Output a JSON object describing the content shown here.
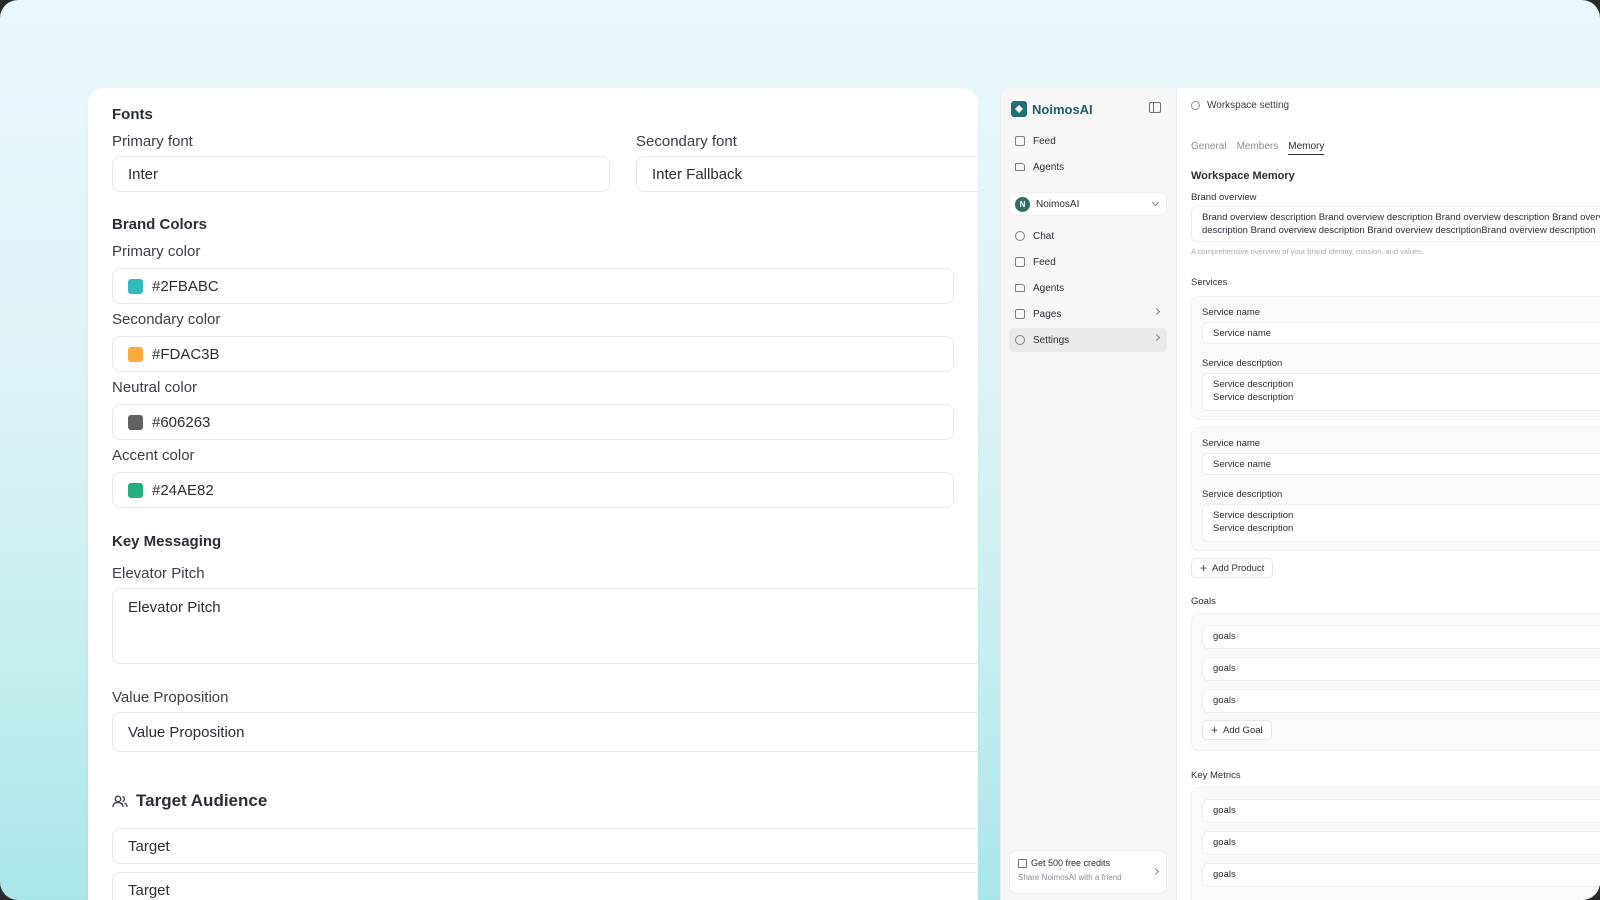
{
  "left": {
    "fonts_heading": "Fonts",
    "primary_font_label": "Primary font",
    "primary_font_value": "Inter",
    "secondary_font_label": "Secondary font",
    "secondary_font_value": "Inter Fallback",
    "brand_colors_heading": "Brand Colors",
    "colors": [
      {
        "label": "Primary color",
        "value": "#2FBABC",
        "swatch": "#2FBABC"
      },
      {
        "label": "Secondary color",
        "value": "#FDAC3B",
        "swatch": "#FDAC3B"
      },
      {
        "label": "Neutral color",
        "value": "#606263",
        "swatch": "#606263"
      },
      {
        "label": "Accent color",
        "value": "#24AE82",
        "swatch": "#24AE82"
      }
    ],
    "key_messaging_heading": "Key Messaging",
    "elevator_label": "Elevator Pitch",
    "elevator_value": "Elevator Pitch",
    "value_prop_label": "Value Proposition",
    "value_prop_value": "Value Proposition",
    "target_heading": "Target Audience",
    "target_icon": "users-icon",
    "targets": [
      "Target",
      "Target"
    ]
  },
  "app": {
    "brand": "NoimosAI",
    "nav_top": [
      {
        "label": "Feed",
        "icon": "feed-icon"
      },
      {
        "label": "Agents",
        "icon": "folder-icon"
      }
    ],
    "workspace": {
      "initial": "N",
      "name": "NoimosAI"
    },
    "nav_ws": [
      {
        "label": "Chat",
        "icon": "chat-icon"
      },
      {
        "label": "Feed",
        "icon": "feed-icon"
      },
      {
        "label": "Agents",
        "icon": "folder-icon"
      },
      {
        "label": "Pages",
        "icon": "pages-icon"
      },
      {
        "label": "Settings",
        "icon": "gear-icon"
      }
    ],
    "credits_title": "Get 500 free credits",
    "credits_sub": "Share NoimosAI with a friend"
  },
  "main": {
    "header": "Workspace setting",
    "tabs": [
      "General",
      "Members",
      "Memory"
    ],
    "active_tab": "Memory",
    "title": "Workspace Memory",
    "brand_overview_label": "Brand overview",
    "brand_overview_line1": "Brand overview description Brand overview description Brand overview description Brand overview",
    "brand_overview_line2": "description Brand overview description Brand overview descriptionBrand overview description",
    "brand_overview_help": "A comprehensive overview of your brand identity, mission, and values.",
    "services_label": "Services",
    "services": [
      {
        "name_label": "Service name",
        "name_value": "Service name",
        "desc_label": "Service description",
        "desc_line1": "Service description",
        "desc_line2": "Service description"
      },
      {
        "name_label": "Service name",
        "name_value": "Service name",
        "desc_label": "Service description",
        "desc_line1": "Service description",
        "desc_line2": "Service description"
      }
    ],
    "add_product": "Add Product",
    "goals_label": "Goals",
    "goals": [
      "goals",
      "goals",
      "goals"
    ],
    "add_goal": "Add Goal",
    "metrics_label": "Key Metrics",
    "metrics": [
      "goals",
      "goals",
      "goals"
    ]
  }
}
